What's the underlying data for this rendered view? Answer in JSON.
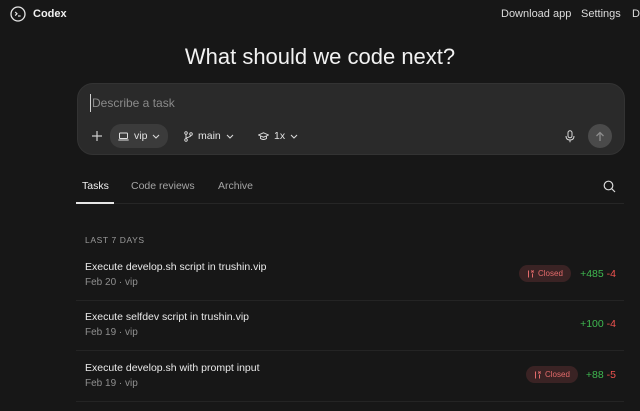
{
  "app": {
    "name": "Codex"
  },
  "topnav": {
    "download": "Download app",
    "settings": "Settings",
    "more": "D"
  },
  "headline": "What should we code next?",
  "composer": {
    "placeholder": "Describe a task",
    "environment": "vip",
    "branch": "main",
    "model_count": "1x",
    "icons": {
      "add": "plus-icon",
      "env": "laptop-icon",
      "branch": "git-branch-icon",
      "model": "graduation-cap-icon",
      "mic": "microphone-icon",
      "send": "arrow-up-icon"
    }
  },
  "tabs": [
    {
      "label": "Tasks",
      "active": true
    },
    {
      "label": "Code reviews",
      "active": false
    },
    {
      "label": "Archive",
      "active": false
    }
  ],
  "section_label": "LAST 7 DAYS",
  "tasks": [
    {
      "title": "Execute develop.sh script in trushin.vip",
      "meta": "Feb 20 · vip",
      "status": "Closed",
      "additions": "+485",
      "deletions": "-4"
    },
    {
      "title": "Execute selfdev script in trushin.vip",
      "meta": "Feb 19 · vip",
      "status": "",
      "additions": "+100",
      "deletions": "-4"
    },
    {
      "title": "Execute develop.sh with prompt input",
      "meta": "Feb 19 · vip",
      "status": "Closed",
      "additions": "+88",
      "deletions": "-5"
    }
  ],
  "colors": {
    "background": "#171717",
    "composer": "#2a2a2a",
    "added": "#3fb950",
    "deleted": "#f0524f",
    "closed_badge_bg": "#3a2324",
    "closed_badge_text": "#e46b6b"
  }
}
